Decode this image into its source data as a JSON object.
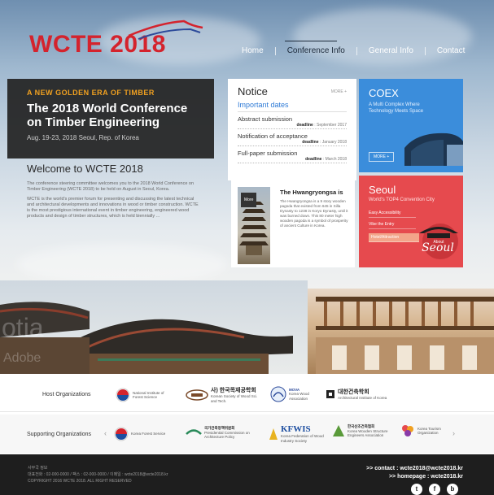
{
  "logo": {
    "text": "WCTE 2018"
  },
  "nav": {
    "items": [
      "Home",
      "Conference Info",
      "General Info",
      "Contact"
    ]
  },
  "conference": {
    "slogan": "A NEW GOLDEN ERA OF TIMBER",
    "title_line1": "The 2018 World Conference",
    "title_line2": "on Timber Engineering",
    "date": "Aug. 19-23, 2018 Seoul, Rep. of Korea"
  },
  "welcome": {
    "title": "Welcome to WCTE 2018",
    "p1": "The conference steering committee welcomes you to the 2018 World Conference on Timber Engineering (WCTE 2018) to be held on August in Seoul, Korea.",
    "p2": "WCTE is the world's premier forum for presenting and discussing the latest technical and architectural developments and innovations in wood or timber construction. WCTE is the most prestigious international event in timber engineering, engineered wood products and design of timber structures, which is held biennially ..."
  },
  "notice": {
    "title": "Notice",
    "more": "MORE +",
    "subtitle": "Important dates",
    "items": [
      {
        "label": "Abstract submission",
        "deadline": "deadline",
        "date": "September 2017"
      },
      {
        "label": "Notification of acceptance",
        "deadline": "deadline",
        "date": "January 2018"
      },
      {
        "label": "Full-paper submission",
        "deadline": "deadline",
        "date": "March 2018"
      }
    ]
  },
  "coex": {
    "title": "COEX",
    "line1": "A Multi Complex Where",
    "line2": "Technology Meets Space",
    "more": "MORE +"
  },
  "hwangryongsa": {
    "more": "More",
    "title": "The Hwangryongsa is",
    "text": "The Hwangryongsa is a 9 story wooden pagoda that existed from 645 in Silla Dynasty to 1238 in Koryo Dynasty, until it was burned down. This 80 meter high wooden pagoda is a symbol of prosperity of ancient Culture in Korea."
  },
  "seoul": {
    "title": "Seoul",
    "subtitle": "World's TOP4 Convention City",
    "links": [
      "Easy Accessibility",
      "Vibe the Entry",
      "Hotel/Attraction"
    ],
    "art_text": "Seoul",
    "art_small": "About"
  },
  "watermark": {
    "line1": "otia",
    "line2": "Adobe"
  },
  "host": {
    "label": "Host Organizations",
    "orgs": [
      {
        "name": "National Institute of Forest Science",
        "icon": "korea-gov-icon"
      },
      {
        "name": "사) 한국목재공학회",
        "sub": "Korean Society of Wood Sci. and Tech.",
        "icon": "kswst-icon"
      },
      {
        "name": "MOVA",
        "sub": "Korea Wood Association",
        "icon": "mova-icon"
      },
      {
        "name": "대한건축학회",
        "sub": "Architectural Institute of Korea",
        "icon": "aik-icon"
      }
    ]
  },
  "support": {
    "label": "Supporting Organizations",
    "orgs": [
      {
        "name": "Korea Forest Service",
        "icon": "korea-gov-icon"
      },
      {
        "name": "국가건축정책위원회",
        "sub": "Presidential Commission on Architecture Policy",
        "icon": "pcap-icon"
      },
      {
        "name": "KFWIS",
        "sub": "Korea Federation of Wood Industry Society",
        "icon": "kfwis-icon"
      },
      {
        "name": "한국산조건축협회",
        "sub": "Korea Wooden Structure Engineers Association",
        "icon": "kwsea-icon"
      },
      {
        "name": "Korea Tourism Organization",
        "icon": "kto-icon"
      }
    ]
  },
  "footer": {
    "line1": "사무국 정보",
    "line2": "대표전화 : 02-000-0000 / 팩스 : 02-000-0000 / 이메일 : wcte2018@wcte2018.kr",
    "line3": "COPYRIGHT 2016 WCTE 2018. ALL RIGHT RESERVED",
    "contact": ">> contact : wcte2018@wcte2018.kr",
    "homepage": ">> homepage : wcte2018.kr",
    "social": [
      "t",
      "f",
      "b"
    ]
  },
  "colors": {
    "brand_red": "#d4232d",
    "coex_blue": "#3b8ddb",
    "seoul_red": "#e64a4e",
    "notice_link": "#2d7ad6",
    "footer_bg": "#1e1e1e"
  }
}
